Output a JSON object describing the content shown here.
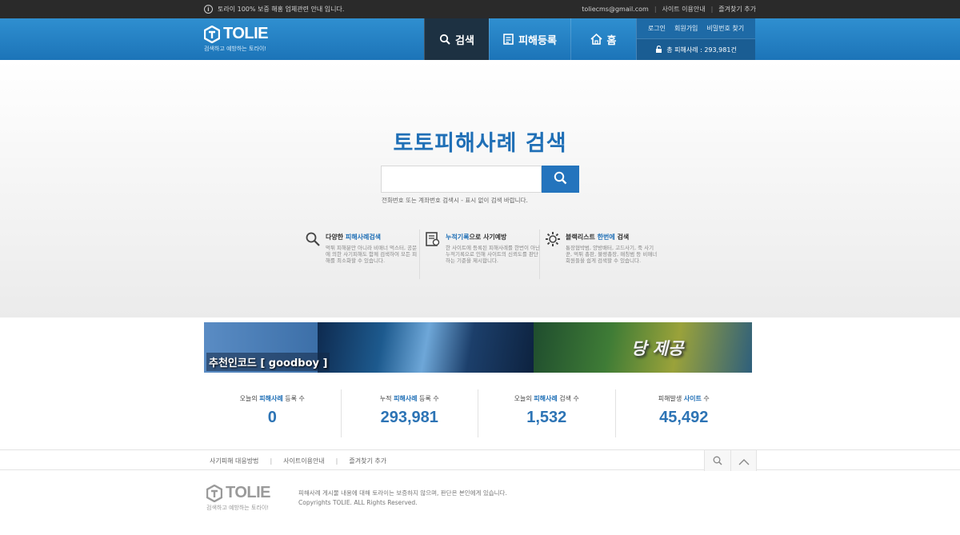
{
  "topbar": {
    "notice": "토라이 100% 보증 해홍 업체관련 안내 입니다.",
    "email": "toliecms@gmail.com",
    "guide": "사이트 이용안내",
    "bookmark": "즐겨찾기 추가"
  },
  "header": {
    "logo_text": "TOLIE",
    "logo_sub": "검색하고 예방하는 토라이!",
    "nav": [
      {
        "label": "검색",
        "icon": "search-icon"
      },
      {
        "label": "피해등록",
        "icon": "document-icon"
      },
      {
        "label": "홈",
        "icon": "home-icon"
      }
    ],
    "account": {
      "login": "로그인",
      "signup": "회원가입",
      "find_password": "비밀번호 찾기",
      "total_cases": "총 피해사례 : 293,981건"
    }
  },
  "hero": {
    "title": "토토피해사례 검색",
    "search_value": "",
    "search_hint": "전화번호 또는 계좌번호 검색시 - 표시 없이 검색 바랍니다.",
    "features": [
      {
        "icon": "magnifier-icon",
        "title_a": "다양한 ",
        "title_hl": "피해사례검색",
        "title_b": "",
        "desc": "먹튀 피해분만 아니라 비매너 먹스터, 공문에 의한 사기피해도 함께 검색하여 모든 피해를 최소화할 수 있습니다."
      },
      {
        "icon": "record-icon",
        "title_a": "",
        "title_hl": "누적기록",
        "title_b": "으로 사기예방",
        "desc": "한 사이트에 등록된 피해사례를 한번이 아닌 누적기록으로 인해 사이트의 신뢰도를 판단하는 기준을 제시합니다."
      },
      {
        "icon": "gear-icon",
        "title_a": "블랙리스트 ",
        "title_hl": "한번에",
        "title_b": " 검색",
        "desc": "통장협박범, 양방배터, 고드사기, 죽 사기꾼, 먹튀 총판, 불량총장, 매칭범 등 비매너 회원들을 쉽게 검색할 수 있습니다."
      }
    ]
  },
  "banner": {
    "code": "추천인코드 [ goodboy ]",
    "slogan": "당 제공"
  },
  "stats": [
    {
      "label_a": "오늘의 ",
      "label_hl": "피해사례",
      "label_b": " 등록 수",
      "value": "0"
    },
    {
      "label_a": "누적 ",
      "label_hl": "피해사례",
      "label_b": " 등록 수",
      "value": "293,981"
    },
    {
      "label_a": "오늘의 ",
      "label_hl": "피해사례",
      "label_b": " 검색 수",
      "value": "1,532"
    },
    {
      "label_a": "피해발생 ",
      "label_hl": "사이트",
      "label_b": " 수",
      "value": "45,492"
    }
  ],
  "footbar": {
    "links": [
      "사기피해 대응방법",
      "사이트이용안내",
      "즐겨찾기 추가"
    ]
  },
  "footer": {
    "logo_text": "TOLIE",
    "logo_sub": "검색하고 예방하는 토라이!",
    "disclaimer": "피해사례 게시물 내용에 대해 토라이는 보증하지 않으며, 판단은 본인에게 있습니다.",
    "copyright": "Copyrights TOLIE. ALL Rights Reserved."
  },
  "colors": {
    "accent": "#1f6fb6",
    "header": "#2f8fd0",
    "nav_active": "#1d3142"
  }
}
